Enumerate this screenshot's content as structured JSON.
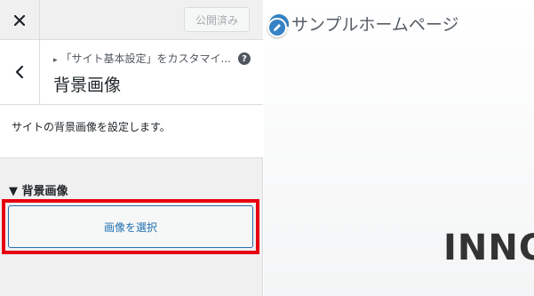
{
  "topbar": {
    "close_icon": "close-icon",
    "publish_label": "公開済み"
  },
  "section": {
    "back_icon": "chevron-left-icon",
    "breadcrumb": "「サイト基本設定」をカスタマイ...",
    "help_icon": "help-icon",
    "help_text": "?",
    "title": "背景画像"
  },
  "description": "サイトの背景画像を設定します。",
  "control": {
    "title": "▼ 背景画像",
    "select_button_label": "画像を選択"
  },
  "preview": {
    "site_title": "サンプルホームページ",
    "edit_icon": "pencil-icon",
    "hero_text": "INNO"
  },
  "colors": {
    "accent": "#2271b1",
    "highlight": "#e60012",
    "edit_shortcut": "#3582c4"
  }
}
